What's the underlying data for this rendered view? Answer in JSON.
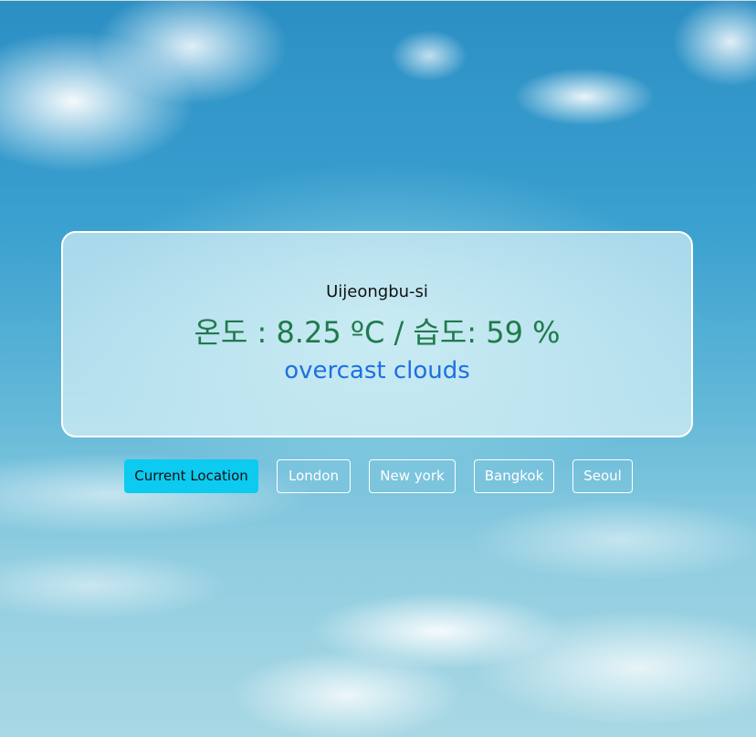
{
  "weather": {
    "city": "Uijeongbu-si",
    "reading": "온도 : 8.25 ºC / 습도: 59 %",
    "description": "overcast clouds"
  },
  "buttons": {
    "current_location": "Current Location",
    "london": "London",
    "new_york": "New york",
    "bangkok": "Bangkok",
    "seoul": "Seoul"
  },
  "colors": {
    "active_button": "#0dcaf0",
    "reading_text": "#1f7a4b",
    "description_text": "#1f6fe0"
  }
}
